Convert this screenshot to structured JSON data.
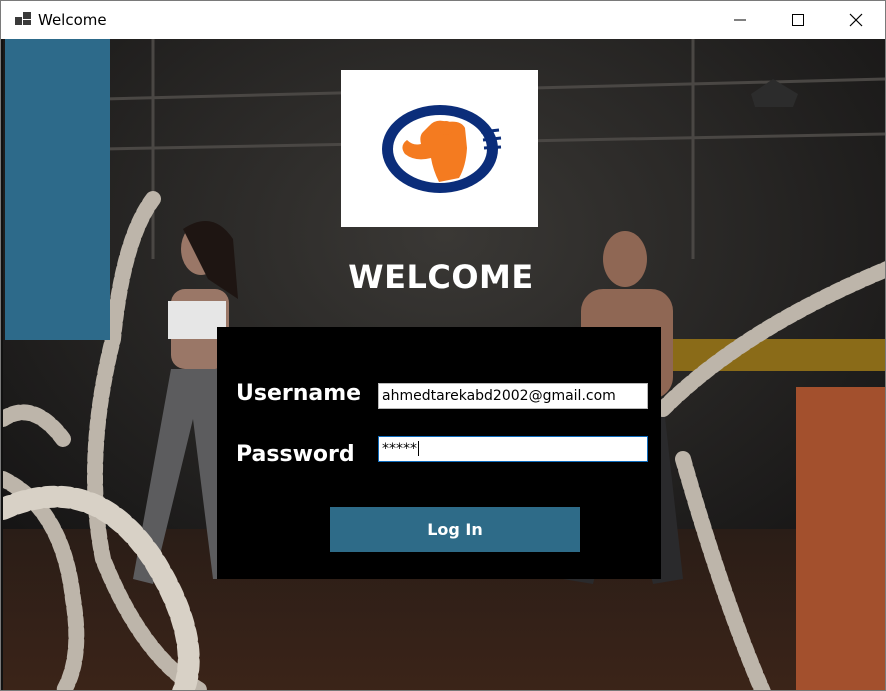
{
  "window": {
    "title": "Welcome"
  },
  "colors": {
    "accent_blue": "#2d6a8a",
    "accent_orange": "#a3502d",
    "button": "#2e6b88",
    "panel": "#000000"
  },
  "logo": {
    "icon": "bodybuilder-logo-icon"
  },
  "heading": "WELCOME",
  "form": {
    "username_label": "Username",
    "username_value": "ahmedtarekabd2002@gmail.com",
    "password_label": "Password",
    "password_value": "*****",
    "login_label": "Log In"
  }
}
